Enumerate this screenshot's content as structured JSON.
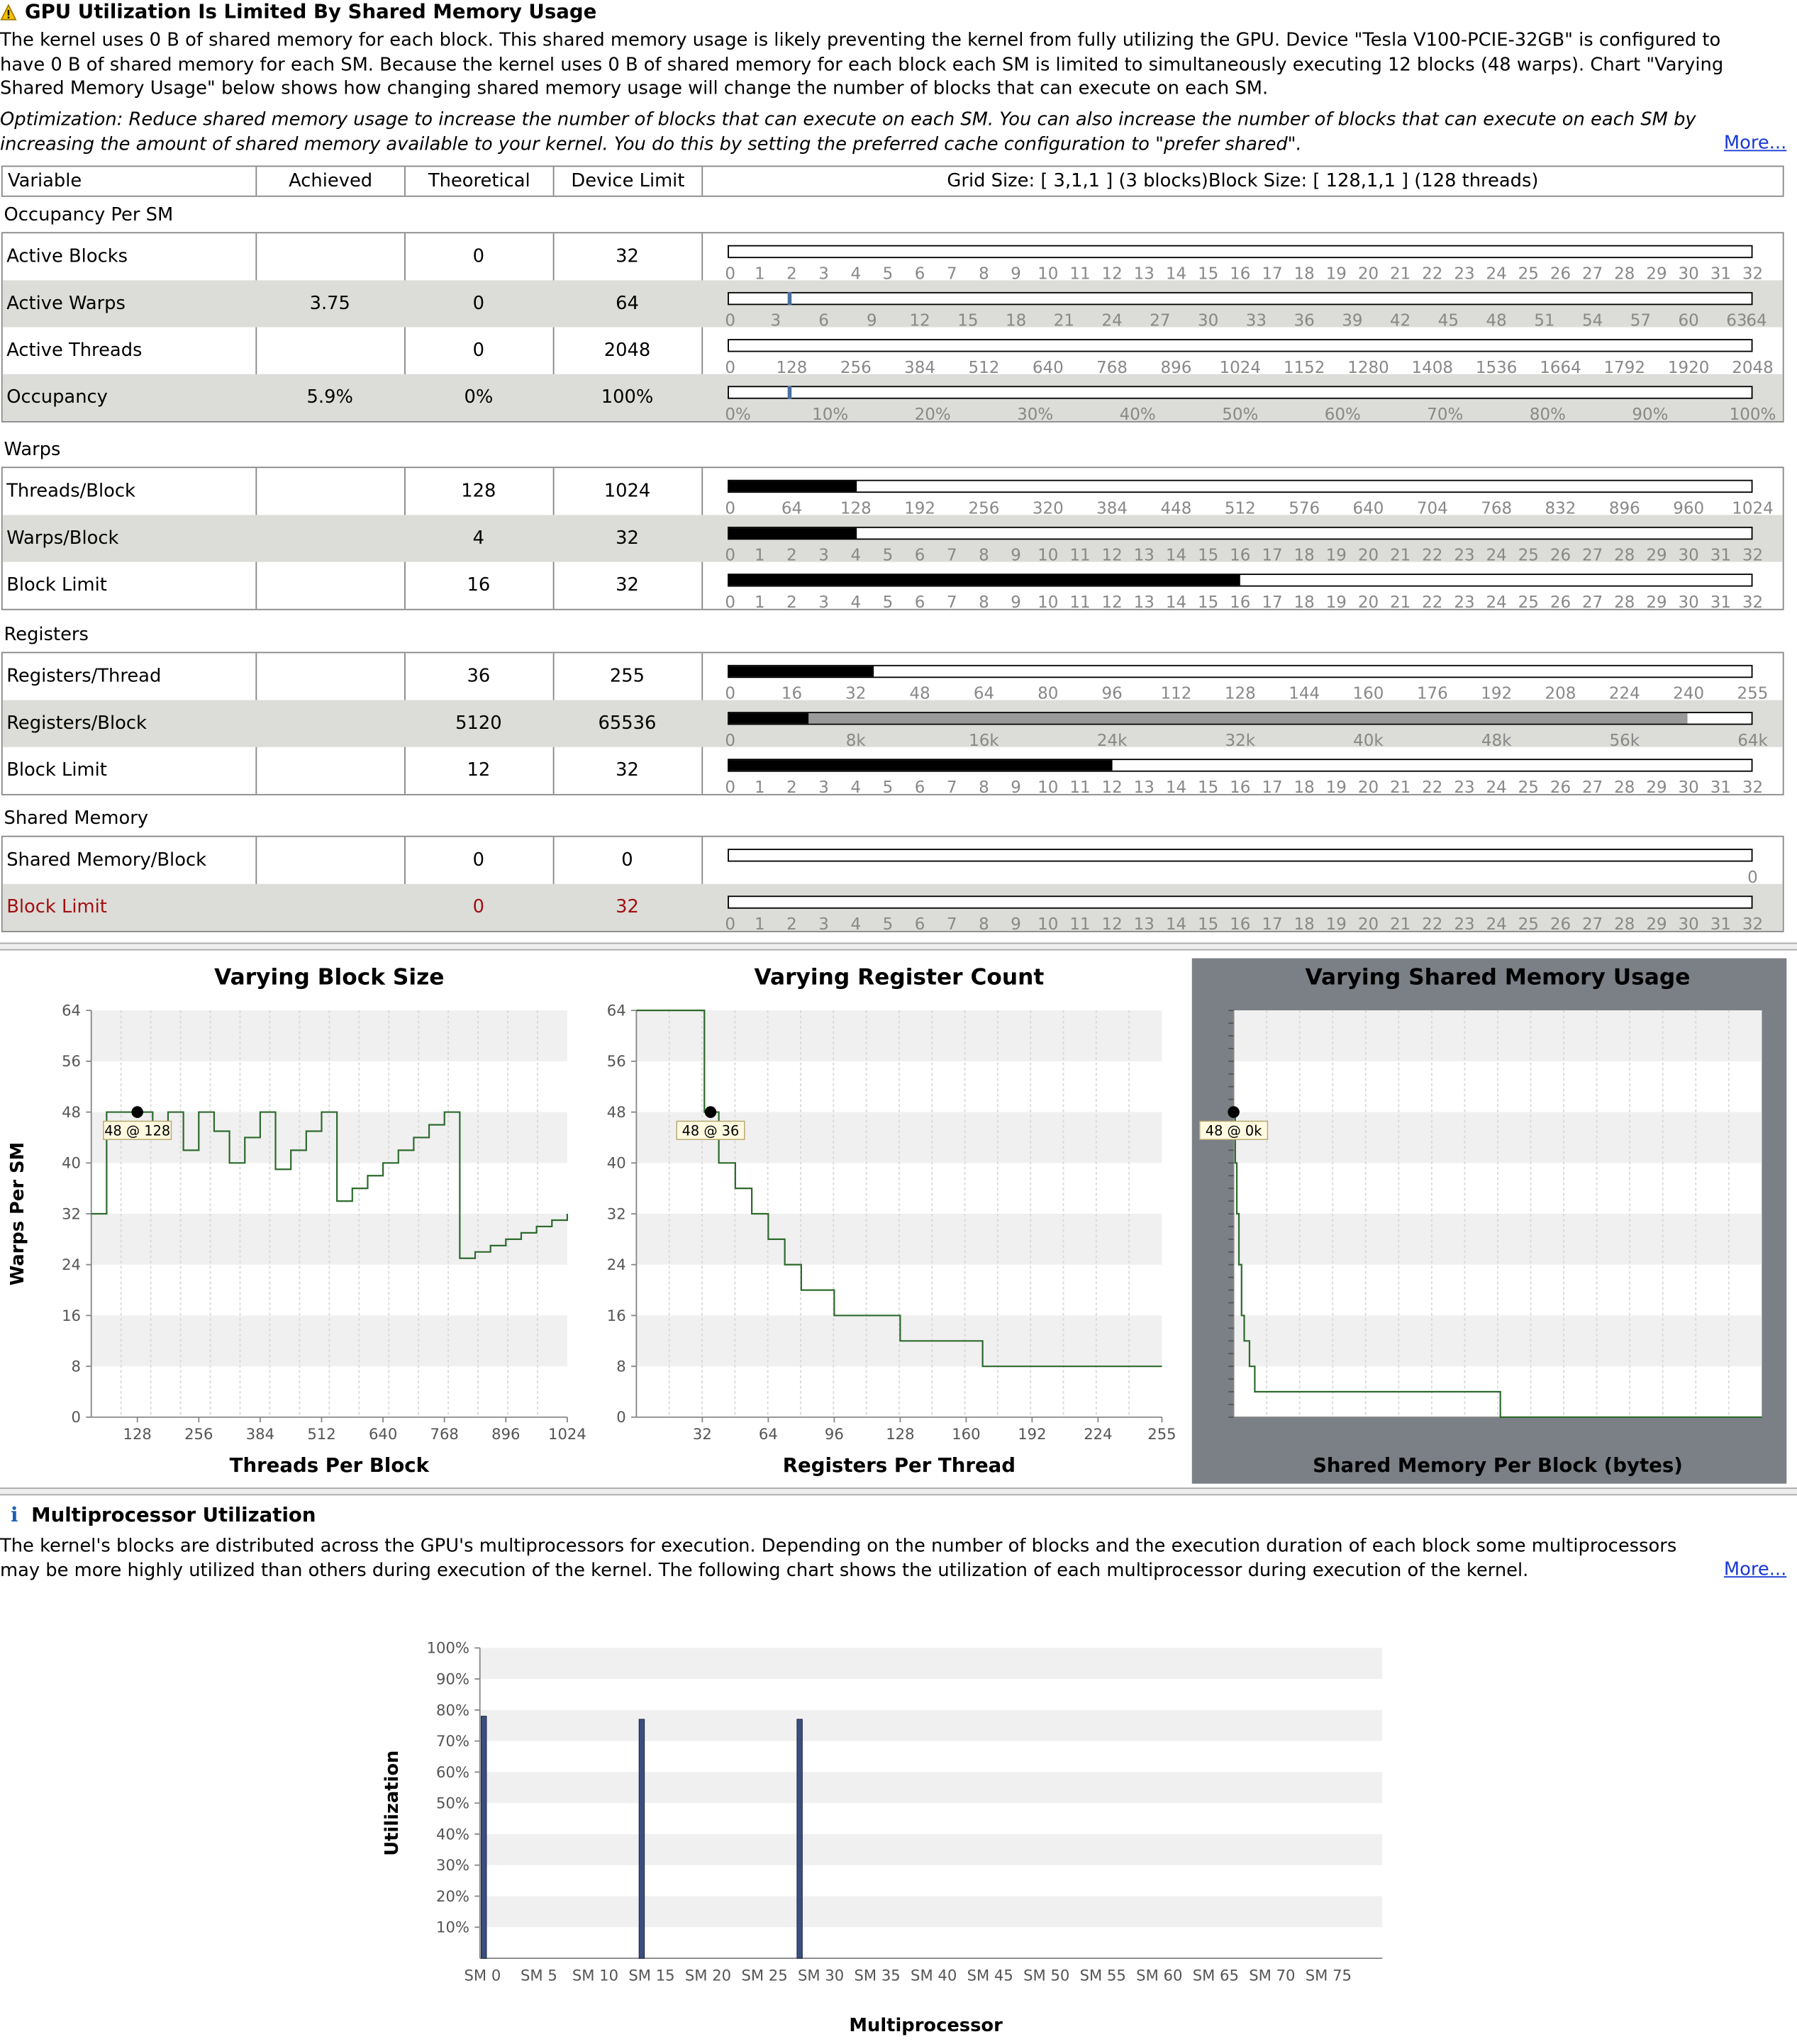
{
  "issue": {
    "title": "GPU Utilization Is Limited By Shared Memory Usage",
    "icon": "warning-icon",
    "description": "The kernel uses 0 B of shared memory for each block. This shared memory usage is likely preventing the kernel from fully utilizing the GPU. Device \"Tesla V100-PCIE-32GB\" is configured to have 0 B of shared memory for each SM. Because the kernel uses 0 B of shared memory for each block each SM is limited to simultaneously executing 12 blocks (48 warps). Chart \"Varying Shared Memory Usage\" below shows how changing shared memory usage will change the number of blocks that can execute on each SM.",
    "optimization": "Optimization: Reduce shared memory usage to increase the number of blocks that can execute on each SM. You can also increase the number of blocks that can execute on each SM by increasing the amount of shared memory available to your kernel. You do this by setting the preferred cache configuration to \"prefer shared\".",
    "more_link": "More..."
  },
  "occupancy_table": {
    "headers": {
      "variable": "Variable",
      "achieved": "Achieved",
      "theoretical": "Theoretical",
      "device_limit": "Device Limit",
      "grid_info": "Grid Size: [ 3,1,1 ] (3 blocks)Block Size: [ 128,1,1 ] (128 threads)"
    },
    "groups": [
      {
        "title": "Occupancy Per SM",
        "rows": [
          {
            "variable": "Active Blocks",
            "achieved": "",
            "theoretical": "0",
            "limit": "32",
            "max": 32,
            "fill": 0,
            "ticks": [
              "0",
              "1",
              "2",
              "3",
              "4",
              "5",
              "6",
              "7",
              "8",
              "9",
              "10",
              "11",
              "12",
              "13",
              "14",
              "15",
              "16",
              "17",
              "18",
              "19",
              "20",
              "21",
              "22",
              "23",
              "24",
              "25",
              "26",
              "27",
              "28",
              "29",
              "30",
              "31",
              "32"
            ]
          },
          {
            "variable": "Active Warps",
            "achieved": "3.75",
            "theoretical": "0",
            "limit": "64",
            "max": 64,
            "fill": 0,
            "marker": 3.75,
            "ticks": [
              "0",
              "3",
              "6",
              "9",
              "12",
              "15",
              "18",
              "21",
              "24",
              "27",
              "30",
              "33",
              "36",
              "39",
              "42",
              "45",
              "48",
              "51",
              "54",
              "57",
              "60",
              "63",
              "64"
            ]
          },
          {
            "variable": "Active Threads",
            "achieved": "",
            "theoretical": "0",
            "limit": "2048",
            "max": 2048,
            "fill": 0,
            "ticks": [
              "0",
              "128",
              "256",
              "384",
              "512",
              "640",
              "768",
              "896",
              "1024",
              "1152",
              "1280",
              "1408",
              "1536",
              "1664",
              "1792",
              "1920",
              "2048"
            ]
          },
          {
            "variable": "Occupancy",
            "achieved": "5.9%",
            "theoretical": "0%",
            "limit": "100%",
            "max": 100,
            "fill": 0,
            "marker": 5.9,
            "ticks": [
              "0%",
              "10%",
              "20%",
              "30%",
              "40%",
              "50%",
              "60%",
              "70%",
              "80%",
              "90%",
              "100%"
            ]
          }
        ]
      },
      {
        "title": "Warps",
        "rows": [
          {
            "variable": "Threads/Block",
            "achieved": "",
            "theoretical": "128",
            "limit": "1024",
            "max": 1024,
            "fill": 128,
            "ticks": [
              "0",
              "64",
              "128",
              "192",
              "256",
              "320",
              "384",
              "448",
              "512",
              "576",
              "640",
              "704",
              "768",
              "832",
              "896",
              "960",
              "1024"
            ]
          },
          {
            "variable": "Warps/Block",
            "achieved": "",
            "theoretical": "4",
            "limit": "32",
            "max": 32,
            "fill": 4,
            "ticks": [
              "0",
              "1",
              "2",
              "3",
              "4",
              "5",
              "6",
              "7",
              "8",
              "9",
              "10",
              "11",
              "12",
              "13",
              "14",
              "15",
              "16",
              "17",
              "18",
              "19",
              "20",
              "21",
              "22",
              "23",
              "24",
              "25",
              "26",
              "27",
              "28",
              "29",
              "30",
              "31",
              "32"
            ]
          },
          {
            "variable": "Block Limit",
            "achieved": "",
            "theoretical": "16",
            "limit": "32",
            "max": 32,
            "fill": 16,
            "ticks": [
              "0",
              "1",
              "2",
              "3",
              "4",
              "5",
              "6",
              "7",
              "8",
              "9",
              "10",
              "11",
              "12",
              "13",
              "14",
              "15",
              "16",
              "17",
              "18",
              "19",
              "20",
              "21",
              "22",
              "23",
              "24",
              "25",
              "26",
              "27",
              "28",
              "29",
              "30",
              "31",
              "32"
            ]
          }
        ]
      },
      {
        "title": "Registers",
        "rows": [
          {
            "variable": "Registers/Thread",
            "achieved": "",
            "theoretical": "36",
            "limit": "255",
            "max": 255,
            "fill": 36,
            "ticks": [
              "0",
              "16",
              "32",
              "48",
              "64",
              "80",
              "96",
              "112",
              "128",
              "144",
              "160",
              "176",
              "192",
              "208",
              "224",
              "240",
              "255"
            ]
          },
          {
            "variable": "Registers/Block",
            "achieved": "",
            "theoretical": "5120",
            "limit": "65536",
            "max": 65536,
            "fill": 5120,
            "grey_fill": 61440,
            "ticks": [
              "0",
              "8k",
              "16k",
              "24k",
              "32k",
              "40k",
              "48k",
              "56k",
              "64k"
            ]
          },
          {
            "variable": "Block Limit",
            "achieved": "",
            "theoretical": "12",
            "limit": "32",
            "max": 32,
            "fill": 12,
            "ticks": [
              "0",
              "1",
              "2",
              "3",
              "4",
              "5",
              "6",
              "7",
              "8",
              "9",
              "10",
              "11",
              "12",
              "13",
              "14",
              "15",
              "16",
              "17",
              "18",
              "19",
              "20",
              "21",
              "22",
              "23",
              "24",
              "25",
              "26",
              "27",
              "28",
              "29",
              "30",
              "31",
              "32"
            ]
          }
        ]
      },
      {
        "title": "Shared Memory",
        "rows": [
          {
            "variable": "Shared Memory/Block",
            "achieved": "",
            "theoretical": "0",
            "limit": "0",
            "max": 0,
            "fill": 0,
            "ticks": [
              "0"
            ],
            "ticks_right": true
          },
          {
            "variable": "Block Limit",
            "achieved": "",
            "theoretical": "0",
            "limit": "32",
            "max": 32,
            "fill": 0,
            "highlight": true,
            "ticks": [
              "0",
              "1",
              "2",
              "3",
              "4",
              "5",
              "6",
              "7",
              "8",
              "9",
              "10",
              "11",
              "12",
              "13",
              "14",
              "15",
              "16",
              "17",
              "18",
              "19",
              "20",
              "21",
              "22",
              "23",
              "24",
              "25",
              "26",
              "27",
              "28",
              "29",
              "30",
              "31",
              "32"
            ]
          }
        ]
      }
    ]
  },
  "chart_data": [
    {
      "type": "line",
      "title": "Varying Block Size",
      "xlabel": "Threads Per Block",
      "ylabel": "Warps Per SM",
      "xlim": [
        32,
        1024
      ],
      "ylim": [
        0,
        64
      ],
      "yticks": [
        0,
        8,
        16,
        24,
        32,
        40,
        48,
        56,
        64
      ],
      "xticks": [
        128,
        256,
        384,
        512,
        640,
        768,
        896,
        1024
      ],
      "step": true,
      "x": [
        32,
        64,
        96,
        128,
        160,
        192,
        224,
        256,
        288,
        320,
        352,
        384,
        416,
        448,
        480,
        512,
        544,
        576,
        608,
        640,
        672,
        704,
        736,
        768,
        800,
        832,
        864,
        896,
        928,
        960,
        992,
        1024
      ],
      "y": [
        32,
        48,
        48,
        48,
        45,
        48,
        42,
        48,
        45,
        40,
        44,
        48,
        39,
        42,
        45,
        48,
        34,
        36,
        38,
        40,
        42,
        44,
        46,
        48,
        25,
        26,
        27,
        28,
        29,
        30,
        31,
        32
      ],
      "current_point": {
        "x": 128,
        "y": 48,
        "label": "48 @ 128"
      }
    },
    {
      "type": "line",
      "title": "Varying Register Count",
      "xlabel": "Registers Per Thread",
      "ylabel": "",
      "xlim": [
        0,
        255
      ],
      "ylim": [
        0,
        64
      ],
      "yticks": [
        0,
        8,
        16,
        24,
        32,
        40,
        48,
        56,
        64
      ],
      "xticks": [
        32,
        64,
        96,
        128,
        160,
        192,
        224,
        255
      ],
      "step": true,
      "x": [
        0,
        32,
        33,
        36,
        40,
        48,
        56,
        64,
        72,
        80,
        96,
        128,
        168,
        255
      ],
      "y": [
        64,
        64,
        48,
        48,
        40,
        36,
        32,
        28,
        24,
        20,
        16,
        12,
        8,
        8
      ],
      "current_point": {
        "x": 36,
        "y": 48,
        "label": "48 @ 36"
      }
    },
    {
      "type": "line",
      "title": "Varying Shared Memory Usage",
      "xlabel": "Shared Memory Per Block (bytes)",
      "ylabel": "",
      "xlim": [
        0,
        100
      ],
      "ylim": [
        0,
        64
      ],
      "step": true,
      "x": [
        0,
        0.3,
        0.6,
        1,
        1.5,
        2,
        3,
        4,
        50,
        50.5,
        100
      ],
      "y": [
        48,
        40,
        32,
        24,
        16,
        12,
        8,
        4,
        4,
        0,
        0
      ],
      "current_point": {
        "x": 0,
        "y": 48,
        "label": "48 @ 0k"
      }
    },
    {
      "type": "bar",
      "title": "",
      "xlabel": "Multiprocessor",
      "ylabel": "Utilization",
      "ylim": [
        0,
        100
      ],
      "yticks": [
        "10%",
        "20%",
        "30%",
        "40%",
        "50%",
        "60%",
        "70%",
        "80%",
        "90%",
        "100%"
      ],
      "xticks": [
        "SM 0",
        "SM 5",
        "SM 10",
        "SM 15",
        "SM 20",
        "SM 25",
        "SM 30",
        "SM 35",
        "SM 40",
        "SM 45",
        "SM 50",
        "SM 55",
        "SM 60",
        "SM 65",
        "SM 70",
        "SM 75"
      ],
      "sm_count": 80,
      "bars": [
        {
          "sm": 0,
          "value": 78
        },
        {
          "sm": 14,
          "value": 77
        },
        {
          "sm": 28,
          "value": 77
        }
      ],
      "color": "#3a4f80"
    }
  ],
  "multiprocessor": {
    "title": "Multiprocessor Utilization",
    "icon": "info-icon",
    "description": "The kernel's blocks are distributed across the GPU's multiprocessors for execution. Depending on the number of blocks and the execution duration of each block some multiprocessors may be more highly utilized than others during execution of the kernel. The following chart shows the utilization of each multiprocessor during execution of the kernel.",
    "more_link": "More..."
  }
}
